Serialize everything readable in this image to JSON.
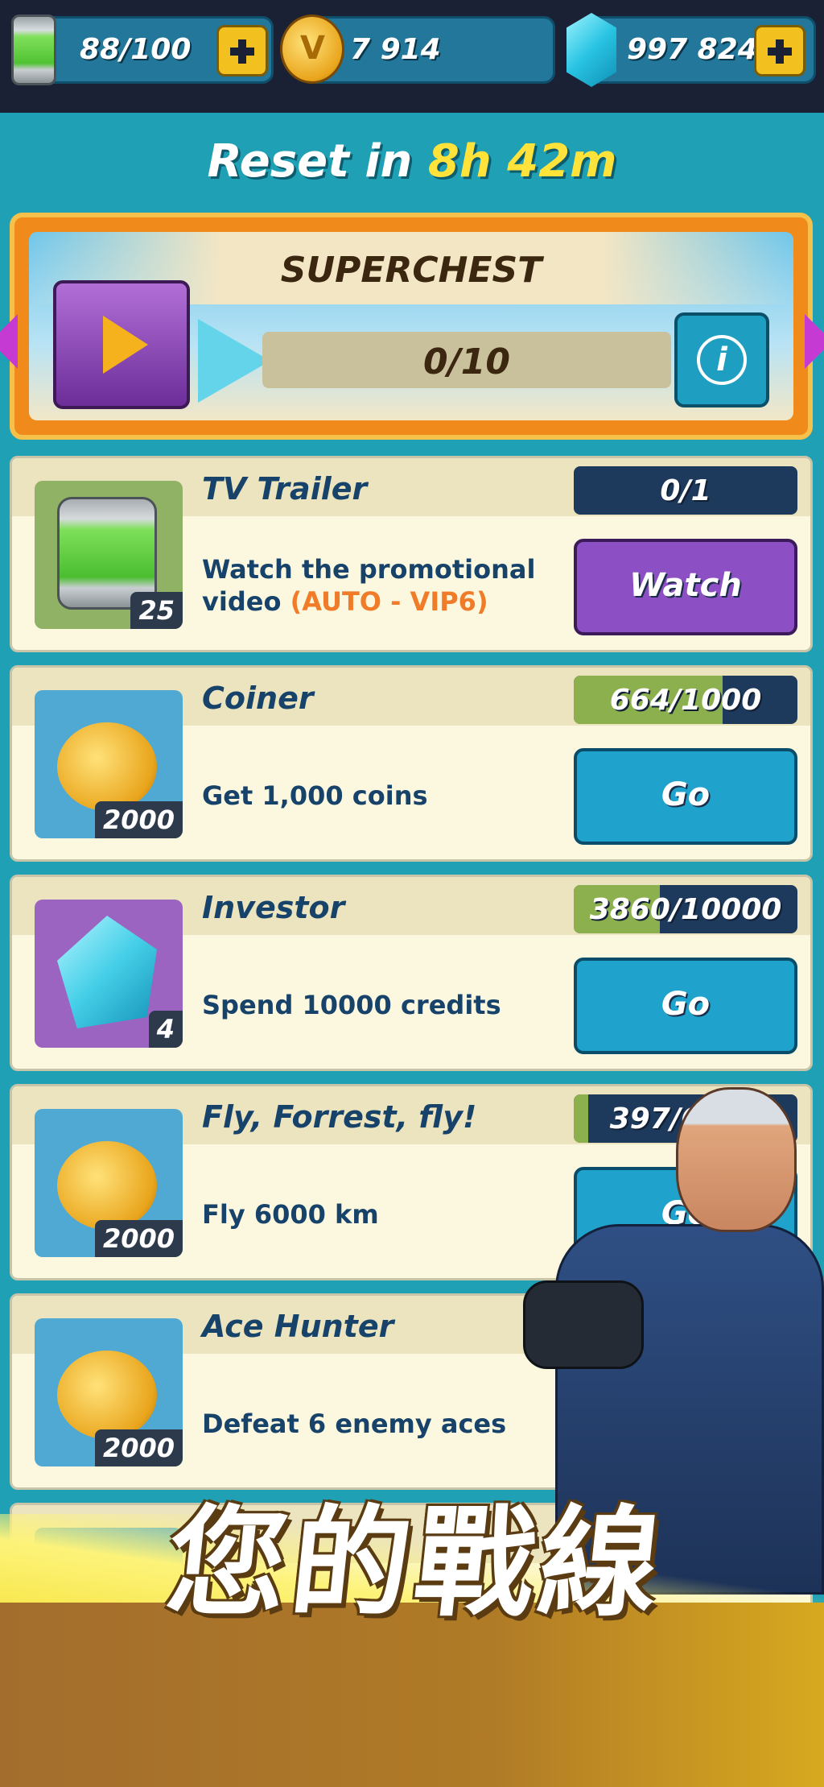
{
  "resources": {
    "energy": "88/100",
    "coins": "7 914",
    "gems": "997 824"
  },
  "reset": {
    "label": "Reset in",
    "time": "8h 42m"
  },
  "superchest": {
    "title": "SUPERCHEST",
    "progress": "0/10",
    "progress_fraction": 0.0
  },
  "quests": [
    {
      "name": "TV Trailer",
      "desc": "Watch the promotional video",
      "desc_highlight": "(AUTO - VIP6)",
      "reward": "25",
      "counter": "0/1",
      "fill": 0.0,
      "button": "Watch"
    },
    {
      "name": "Coiner",
      "desc": "Get 1,000 coins",
      "reward": "2000",
      "counter": "664/1000",
      "fill": 0.664,
      "button": "Go"
    },
    {
      "name": "Investor",
      "desc": "Spend 10000 credits",
      "reward": "4",
      "counter": "3860/10000",
      "fill": 0.386,
      "button": "Go"
    },
    {
      "name": "Fly, Forrest, fly!",
      "desc": "Fly 6000 km",
      "reward": "2000",
      "counter": "397/6000",
      "fill": 0.066,
      "button": "Go"
    },
    {
      "name": "Ace Hunter",
      "desc": "Defeat 6 enemy aces",
      "reward": "2000"
    }
  ],
  "promo_text": "您的戰線",
  "colors": {
    "accent_green": "#8db04e",
    "go_button": "#1fa3cc",
    "watch_button": "#8c4fc4"
  }
}
